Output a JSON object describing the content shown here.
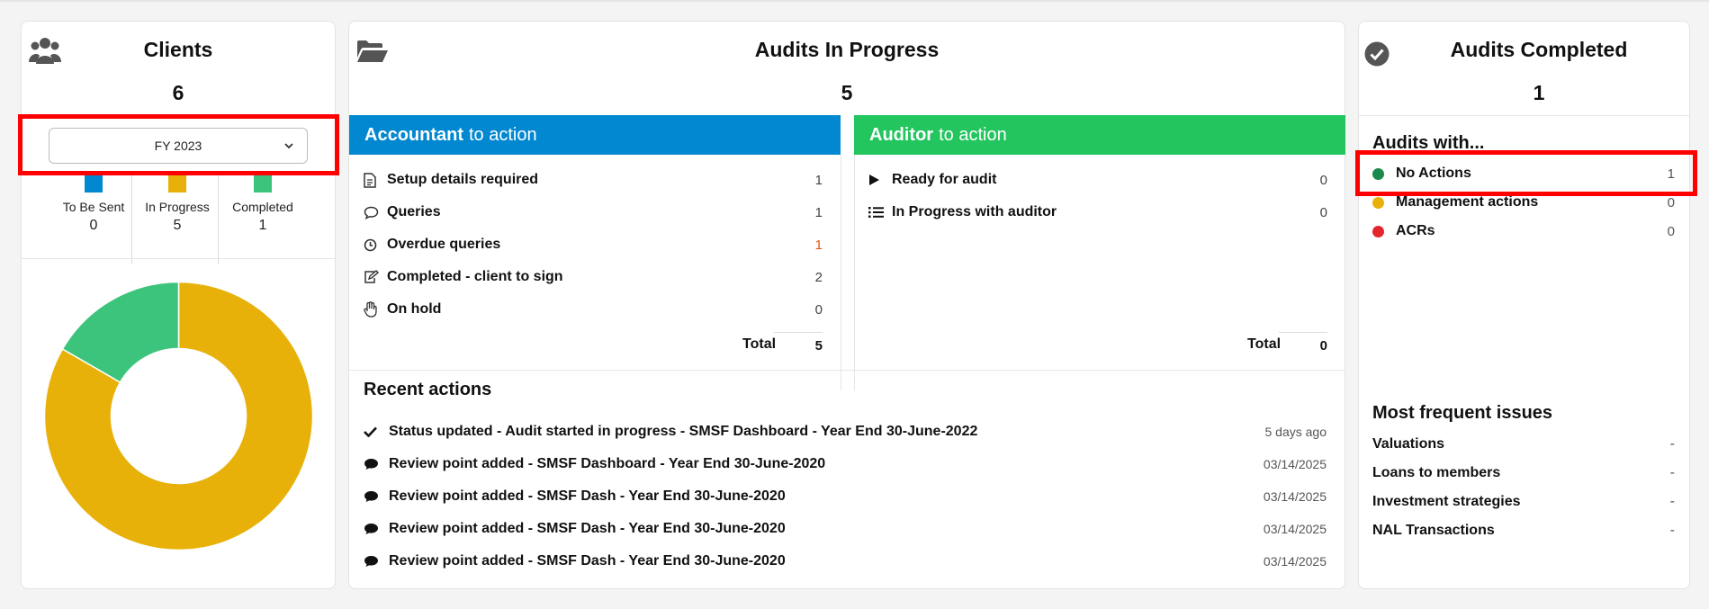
{
  "clients": {
    "title": "Clients",
    "count": "6",
    "fy_select": {
      "value": "FY 2023"
    },
    "legend": [
      {
        "label": "To Be Sent",
        "value": "0",
        "color": "#0288d1"
      },
      {
        "label": "In Progress",
        "value": "5",
        "color": "#e8b10a"
      },
      {
        "label": "Completed",
        "value": "1",
        "color": "#3cc47c"
      }
    ]
  },
  "chart_data": {
    "type": "pie",
    "categories": [
      "To Be Sent",
      "In Progress",
      "Completed"
    ],
    "values": [
      0,
      5,
      1
    ],
    "colors": [
      "#0288d1",
      "#e8b10a",
      "#3cc47c"
    ],
    "donut": true
  },
  "progress": {
    "title": "Audits In Progress",
    "count": "5",
    "accountant": {
      "title_bold": "Accountant",
      "title_rest": "to action",
      "color": "#0288d1",
      "items": [
        {
          "icon": "document-icon",
          "label": "Setup details required",
          "value": "1"
        },
        {
          "icon": "speech-bubble-icon",
          "label": "Queries",
          "value": "1"
        },
        {
          "icon": "clock-icon",
          "label": "Overdue queries",
          "value": "1",
          "value_color": "#e0561b"
        },
        {
          "icon": "edit-icon",
          "label": "Completed - client to sign",
          "value": "2"
        },
        {
          "icon": "hand-icon",
          "label": "On hold",
          "value": "0"
        }
      ],
      "total_label": "Total",
      "total_value": "5"
    },
    "auditor": {
      "title_bold": "Auditor",
      "title_rest": "to action",
      "color": "#23c55e",
      "items": [
        {
          "icon": "play-icon",
          "label": "Ready for audit",
          "value": "0"
        },
        {
          "icon": "list-icon",
          "label": "In Progress with auditor",
          "value": "0"
        }
      ],
      "total_label": "Total",
      "total_value": "0"
    },
    "recent": {
      "title": "Recent actions",
      "items": [
        {
          "icon": "check-icon",
          "text": "Status updated - Audit started in progress - SMSF Dashboard - Year End 30-June-2022",
          "date": "5 days ago"
        },
        {
          "icon": "comment-icon",
          "text": "Review point added - SMSF Dashboard - Year End 30-June-2020",
          "date": "03/14/2025"
        },
        {
          "icon": "comment-icon",
          "text": "Review point added - SMSF Dash - Year End 30-June-2020",
          "date": "03/14/2025"
        },
        {
          "icon": "comment-icon",
          "text": "Review point added - SMSF Dash - Year End 30-June-2020",
          "date": "03/14/2025"
        },
        {
          "icon": "comment-icon",
          "text": "Review point added - SMSF Dash - Year End 30-June-2020",
          "date": "03/14/2025"
        }
      ]
    }
  },
  "completed": {
    "title": "Audits Completed",
    "count": "1",
    "audits_with_title": "Audits with...",
    "audits_with": [
      {
        "label": "No Actions",
        "value": "1",
        "color": "#1a8a4a"
      },
      {
        "label": "Management actions",
        "value": "0",
        "color": "#e8b10a"
      },
      {
        "label": "ACRs",
        "value": "0",
        "color": "#e5252d"
      }
    ],
    "issues_title": "Most frequent issues",
    "issues": [
      {
        "label": "Valuations",
        "value": "-"
      },
      {
        "label": "Loans to members",
        "value": "-"
      },
      {
        "label": "Investment strategies",
        "value": "-"
      },
      {
        "label": "NAL Transactions",
        "value": "-"
      }
    ]
  }
}
